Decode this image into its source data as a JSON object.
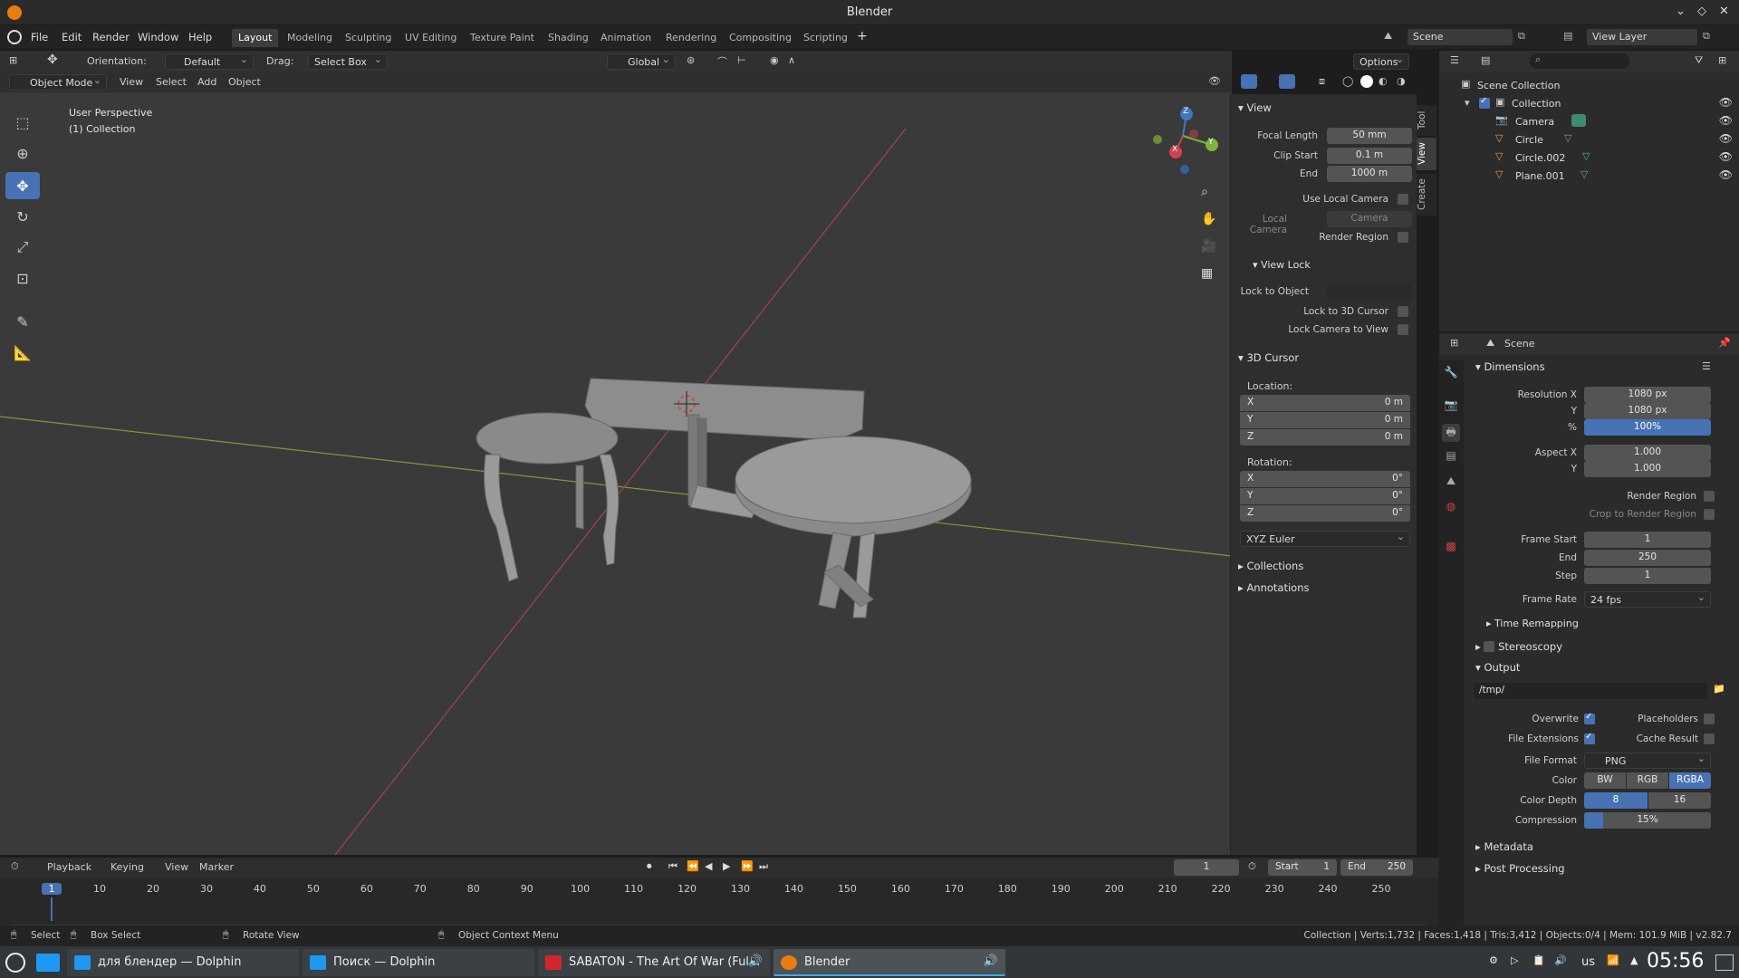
{
  "window": {
    "title": "Blender"
  },
  "menu": [
    "File",
    "Edit",
    "Render",
    "Window",
    "Help"
  ],
  "workspaces": [
    "Layout",
    "Modeling",
    "Sculpting",
    "UV Editing",
    "Texture Paint",
    "Shading",
    "Animation",
    "Rendering",
    "Compositing",
    "Scripting"
  ],
  "header_right": {
    "scene": "Scene",
    "view_layer": "View Layer"
  },
  "toolhdr": {
    "orientation_label": "Orientation:",
    "orientation_value": "Default",
    "drag_label": "Drag:",
    "drag_value": "Select Box",
    "transform_orientation": "Global",
    "options": "Options"
  },
  "viewhdr": {
    "mode": "Object Mode",
    "items": [
      "View",
      "Select",
      "Add",
      "Object"
    ]
  },
  "viewport": {
    "perspective": "User Perspective",
    "collection": "(1) Collection",
    "gizmo_axes": [
      "Z",
      "Y",
      "X"
    ]
  },
  "npanel": {
    "tabs": [
      "Tool",
      "View",
      "Create"
    ],
    "view": {
      "title": "View",
      "focal_length_label": "Focal Length",
      "focal_length": "50 mm",
      "clip_start_label": "Clip Start",
      "clip_start": "0.1 m",
      "end_label": "End",
      "end": "1000 m",
      "use_local_camera": "Use Local Camera",
      "local_camera_label": "Local Camera",
      "local_camera": "Camera",
      "render_region": "Render Region"
    },
    "view_lock": {
      "title": "View Lock",
      "lock_object_label": "Lock to Object",
      "lock_cursor": "Lock to 3D Cursor",
      "lock_camera": "Lock Camera to View"
    },
    "cursor": {
      "title": "3D Cursor",
      "location_label": "Location:",
      "rotation_label": "Rotation:",
      "loc": [
        {
          "axis": "X",
          "v": "0 m"
        },
        {
          "axis": "Y",
          "v": "0 m"
        },
        {
          "axis": "Z",
          "v": "0 m"
        }
      ],
      "rot": [
        {
          "axis": "X",
          "v": "0°"
        },
        {
          "axis": "Y",
          "v": "0°"
        },
        {
          "axis": "Z",
          "v": "0°"
        }
      ],
      "rotation_mode": "XYZ Euler"
    },
    "collapsed": [
      "Collections",
      "Annotations"
    ]
  },
  "outliner": {
    "root": "Scene Collection",
    "collection": "Collection",
    "objects": [
      "Camera",
      "Circle",
      "Circle.002",
      "Plane.001"
    ]
  },
  "properties": {
    "context": "Scene",
    "dimensions": {
      "title": "Dimensions",
      "res_x_label": "Resolution X",
      "res_x": "1080 px",
      "res_y_label": "Y",
      "res_y": "1080 px",
      "pct_label": "%",
      "pct": "100%",
      "aspect_x_label": "Aspect X",
      "aspect_x": "1.000",
      "aspect_y_label": "Y",
      "aspect_y": "1.000",
      "render_region": "Render Region",
      "crop": "Crop to Render Region",
      "frame_start_label": "Frame Start",
      "frame_start": "1",
      "end_label": "End",
      "end": "250",
      "step_label": "Step",
      "step": "1",
      "frame_rate_label": "Frame Rate",
      "frame_rate": "24 fps"
    },
    "time_remapping": "Time Remapping",
    "stereoscopy": "Stereoscopy",
    "output": {
      "title": "Output",
      "path": "/tmp/",
      "overwrite": "Overwrite",
      "placeholders": "Placeholders",
      "file_ext": "File Extensions",
      "cache": "Cache Result",
      "format_label": "File Format",
      "format": "PNG",
      "color_label": "Color",
      "colors": [
        "BW",
        "RGB",
        "RGBA"
      ],
      "depth_label": "Color Depth",
      "depths": [
        "8",
        "16"
      ],
      "compression_label": "Compression",
      "compression": "15%"
    },
    "metadata": "Metadata",
    "post_processing": "Post Processing"
  },
  "timeline": {
    "menus": [
      "Playback",
      "Keying",
      "View",
      "Marker"
    ],
    "current_frame": "1",
    "start_label": "Start",
    "start": "1",
    "end_label": "End",
    "end": "250",
    "ticks": [
      "1",
      "10",
      "20",
      "30",
      "40",
      "50",
      "60",
      "70",
      "80",
      "90",
      "100",
      "110",
      "120",
      "130",
      "140",
      "150",
      "160",
      "170",
      "180",
      "190",
      "200",
      "210",
      "220",
      "230",
      "240",
      "250"
    ]
  },
  "statusbar": {
    "select": "Select",
    "box_select": "Box Select",
    "rotate": "Rotate View",
    "context_menu": "Object Context Menu",
    "stats": "Collection | Verts:1,732 | Faces:1,418 | Tris:3,412 | Objects:0/4 | Mem: 101.9 MiB | v2.82.7"
  },
  "taskbar": {
    "tasks": [
      "для блендер — Dolphin",
      "Поиск — Dolphin",
      "SABATON - The Art Of War (Ful...",
      "Blender"
    ],
    "layout": "us",
    "time": "05:56"
  }
}
